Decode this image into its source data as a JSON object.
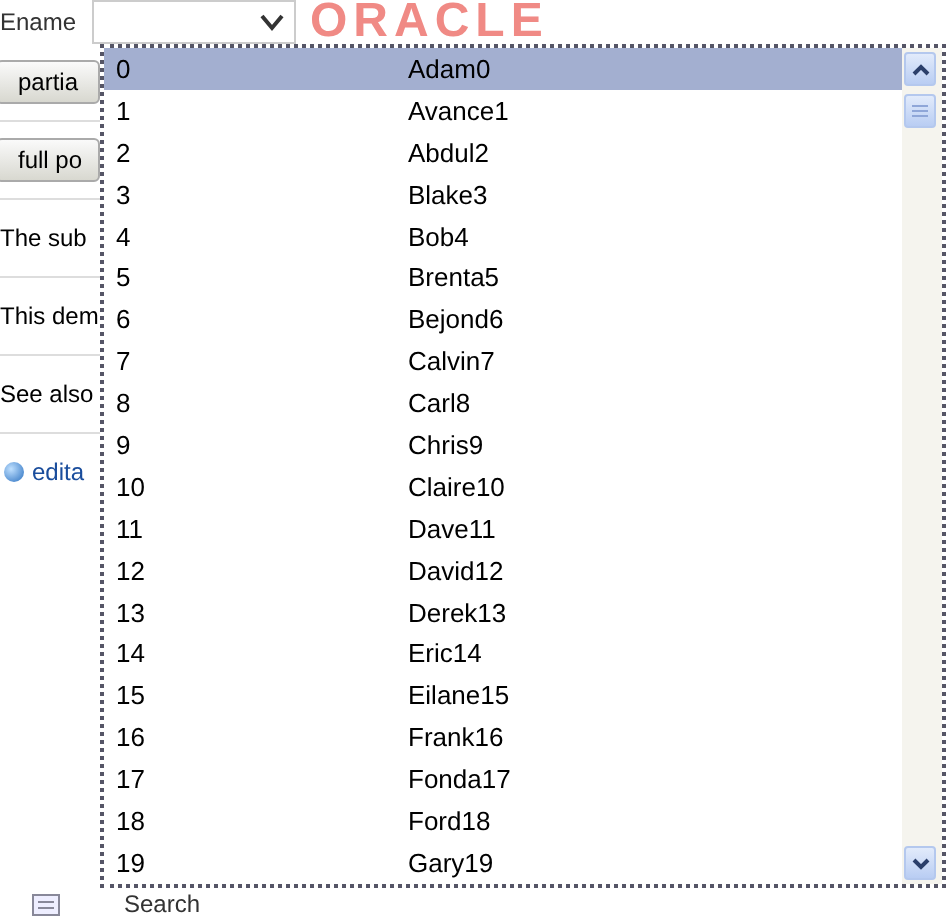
{
  "field": {
    "label": "Ename",
    "logo": "ORACLE"
  },
  "background": [
    {
      "kind": "button",
      "text": "partia"
    },
    {
      "kind": "button",
      "text": "full po"
    },
    {
      "kind": "text",
      "text": "The sub"
    },
    {
      "kind": "text",
      "text": "This dem"
    },
    {
      "kind": "text",
      "text": "See also"
    },
    {
      "kind": "link",
      "text": "edita"
    }
  ],
  "popup": {
    "rows": [
      {
        "id": "0",
        "name": "Adam0",
        "selected": true
      },
      {
        "id": "1",
        "name": "Avance1",
        "selected": false
      },
      {
        "id": "2",
        "name": "Abdul2",
        "selected": false
      },
      {
        "id": "3",
        "name": "Blake3",
        "selected": false
      },
      {
        "id": "4",
        "name": "Bob4",
        "selected": false
      },
      {
        "id": "5",
        "name": "Brenta5",
        "selected": false
      },
      {
        "id": "6",
        "name": "Bejond6",
        "selected": false
      },
      {
        "id": "7",
        "name": "Calvin7",
        "selected": false
      },
      {
        "id": "8",
        "name": "Carl8",
        "selected": false
      },
      {
        "id": "9",
        "name": "Chris9",
        "selected": false
      },
      {
        "id": "10",
        "name": "Claire10",
        "selected": false
      },
      {
        "id": "11",
        "name": "Dave11",
        "selected": false
      },
      {
        "id": "12",
        "name": "David12",
        "selected": false
      },
      {
        "id": "13",
        "name": "Derek13",
        "selected": false
      },
      {
        "id": "14",
        "name": "Eric14",
        "selected": false
      },
      {
        "id": "15",
        "name": "Eilane15",
        "selected": false
      },
      {
        "id": "16",
        "name": "Frank16",
        "selected": false
      },
      {
        "id": "17",
        "name": "Fonda17",
        "selected": false
      },
      {
        "id": "18",
        "name": "Ford18",
        "selected": false
      },
      {
        "id": "19",
        "name": "Gary19",
        "selected": false
      }
    ]
  },
  "footer": {
    "text": "Search"
  }
}
